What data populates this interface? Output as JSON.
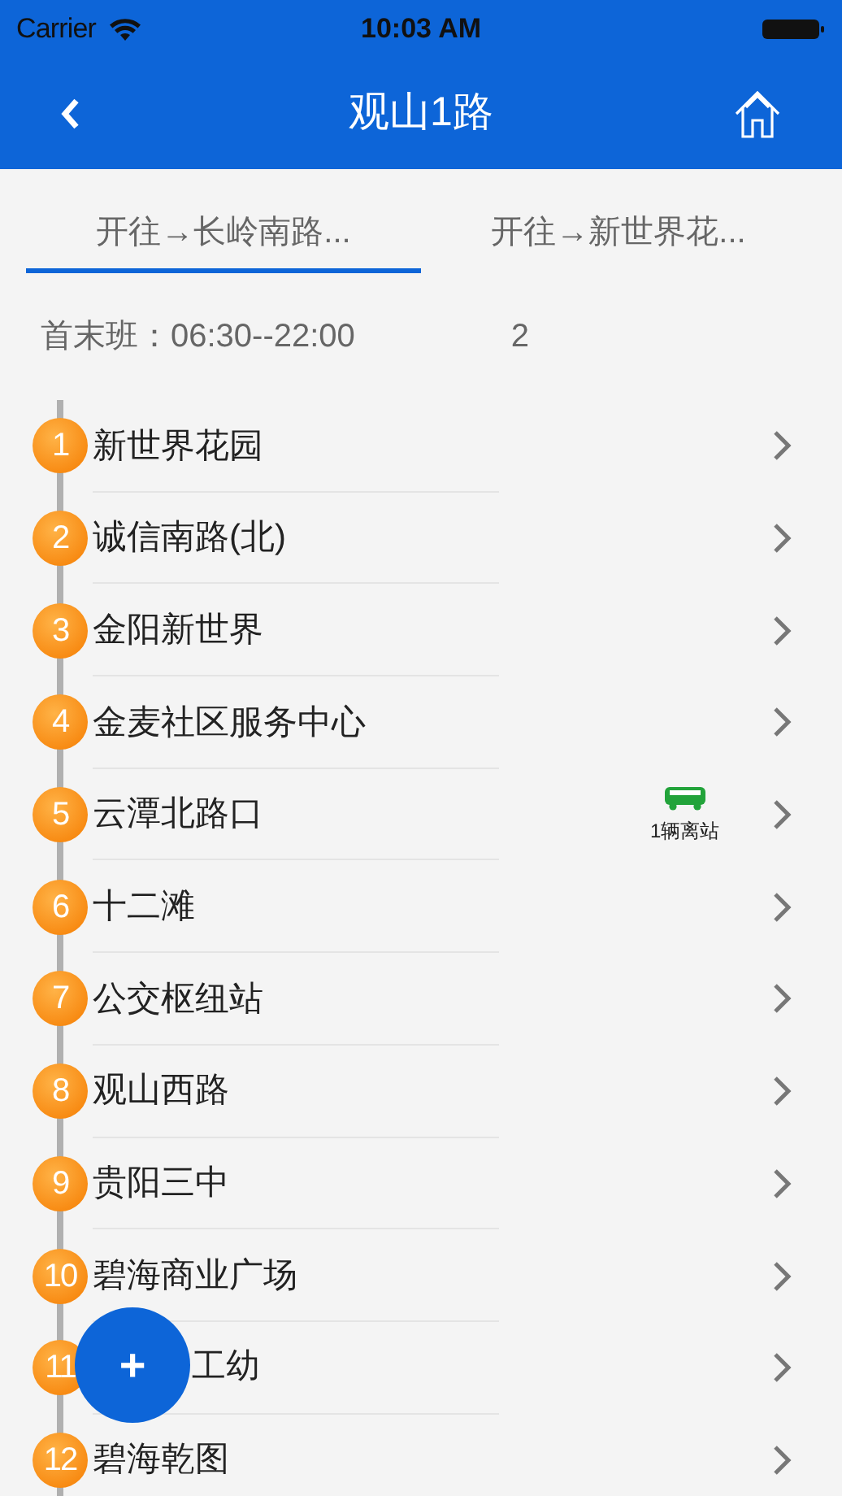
{
  "status_bar": {
    "carrier": "Carrier",
    "time": "10:03 AM"
  },
  "nav": {
    "title": "观山1路"
  },
  "tabs": [
    {
      "label": "开往→长岭南路...",
      "selected": true
    },
    {
      "label": "开往→新世界花...",
      "selected": false
    }
  ],
  "schedule": {
    "text": "首末班：06:30--22:00",
    "count": "2"
  },
  "stops": [
    {
      "number": "1",
      "name": "新世界花园"
    },
    {
      "number": "2",
      "name": "诚信南路(北)"
    },
    {
      "number": "3",
      "name": "金阳新世界"
    },
    {
      "number": "4",
      "name": "金麦社区服务中心"
    },
    {
      "number": "5",
      "name": "云潭北路口",
      "bus": {
        "label": "1辆离站"
      }
    },
    {
      "number": "6",
      "name": "十二滩"
    },
    {
      "number": "7",
      "name": "公交枢纽站"
    },
    {
      "number": "8",
      "name": "观山西路"
    },
    {
      "number": "9",
      "name": "贵阳三中"
    },
    {
      "number": "10",
      "name": "碧海商业广场"
    },
    {
      "number": "11",
      "name": "工幼",
      "partly_hidden": true
    },
    {
      "number": "12",
      "name": "碧海乾图"
    }
  ],
  "fab": {
    "label": "+"
  }
}
